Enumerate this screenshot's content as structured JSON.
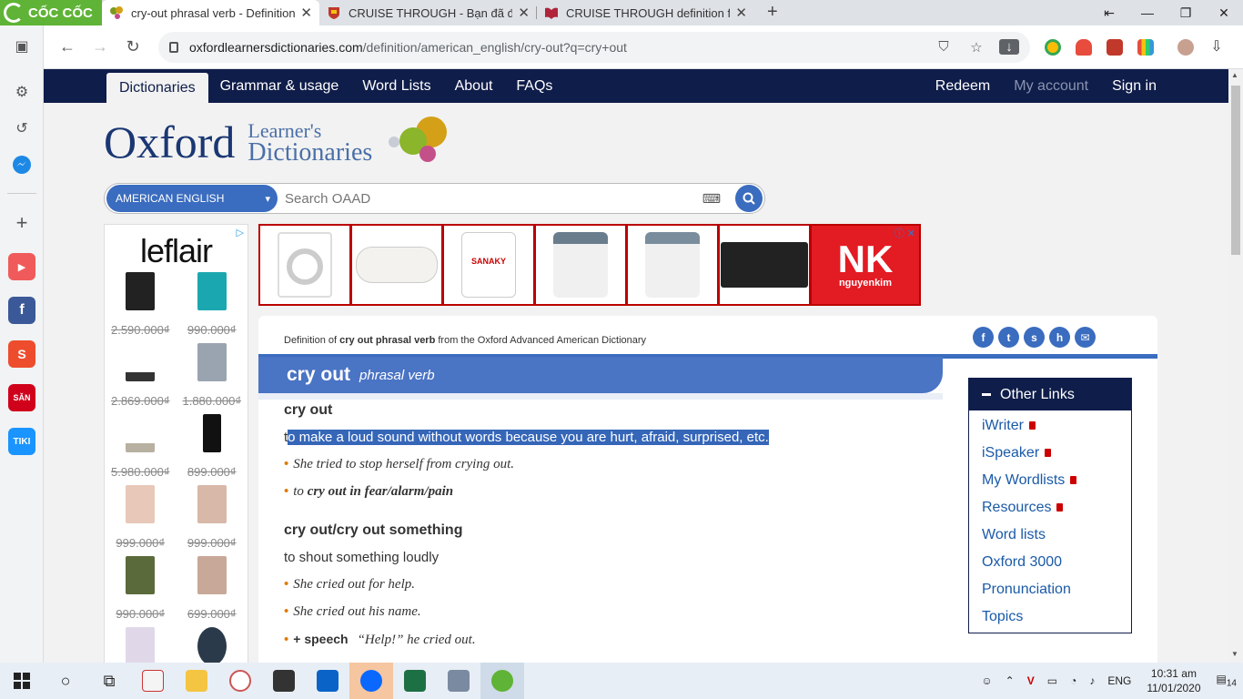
{
  "browser": {
    "brand": "CỐC CỐC",
    "tabs": [
      {
        "title": "cry-out phrasal verb - Definition, p",
        "active": true
      },
      {
        "title": "CRUISE THROUGH - Bạn đã đánh v",
        "active": false
      },
      {
        "title": "CRUISE THROUGH definition from",
        "active": false
      }
    ],
    "url_host": "oxfordlearnersdictionaries.com",
    "url_path": "/definition/american_english/cry-out?q=cry+out"
  },
  "site_nav": {
    "left": [
      "Dictionaries",
      "Grammar & usage",
      "Word Lists",
      "About",
      "FAQs"
    ],
    "right": [
      "Redeem",
      "My account",
      "Sign in"
    ]
  },
  "logo": {
    "oxford": "Oxford",
    "line1": "Learner's",
    "line2": "Dictionaries"
  },
  "search": {
    "language": "AMERICAN ENGLISH",
    "placeholder": "Search OAAD"
  },
  "left_ad": {
    "brand": "leflair",
    "prices": [
      "2.590.000₫",
      "990.000₫",
      "2.869.000₫",
      "1.880.000₫",
      "5.980.000₫",
      "899.000₫",
      "999.000₫",
      "999.000₫",
      "990.000₫",
      "699.000₫"
    ]
  },
  "top_ad": {
    "brand_big": "NK",
    "brand_small": "nguyenkim"
  },
  "entry": {
    "definition_prefix": "Definition of",
    "definition_word": "cry out phrasal verb",
    "definition_suffix": "from the Oxford Advanced American Dictionary",
    "headword": "cry out",
    "pos": "phrasal verb",
    "sense1": {
      "head": "cry out",
      "def_first": "t",
      "def_highlighted": "o make a loud sound without words because you are hurt, afraid, surprised, etc.",
      "ex1": "She tried to stop herself from crying out.",
      "ex2_pre": "to",
      "ex2_bold": "cry out in fear/alarm/pain"
    },
    "sense2": {
      "head": "cry out/cry out something",
      "def": "to shout something loudly",
      "ex1": "She cried out for help.",
      "ex2": "She cried out his name.",
      "ex3_gram": "+ speech",
      "ex3": "“Help!” he cried out."
    }
  },
  "other_links": {
    "title": "Other Links",
    "items": [
      {
        "label": "iWriter",
        "locked": true
      },
      {
        "label": "iSpeaker",
        "locked": true
      },
      {
        "label": "My Wordlists",
        "locked": true
      },
      {
        "label": "Resources",
        "locked": true
      },
      {
        "label": "Word lists",
        "locked": false
      },
      {
        "label": "Oxford 3000",
        "locked": false
      },
      {
        "label": "Pronunciation",
        "locked": false
      },
      {
        "label": "Topics",
        "locked": false
      }
    ]
  },
  "taskbar": {
    "language": "ENG",
    "time": "10:31 am",
    "date": "11/01/2020",
    "notifications": "14"
  },
  "colors": {
    "oxford_navy": "#0f1d4a",
    "oxford_blue": "#4a74c4",
    "bullet_orange": "#e07b00"
  }
}
